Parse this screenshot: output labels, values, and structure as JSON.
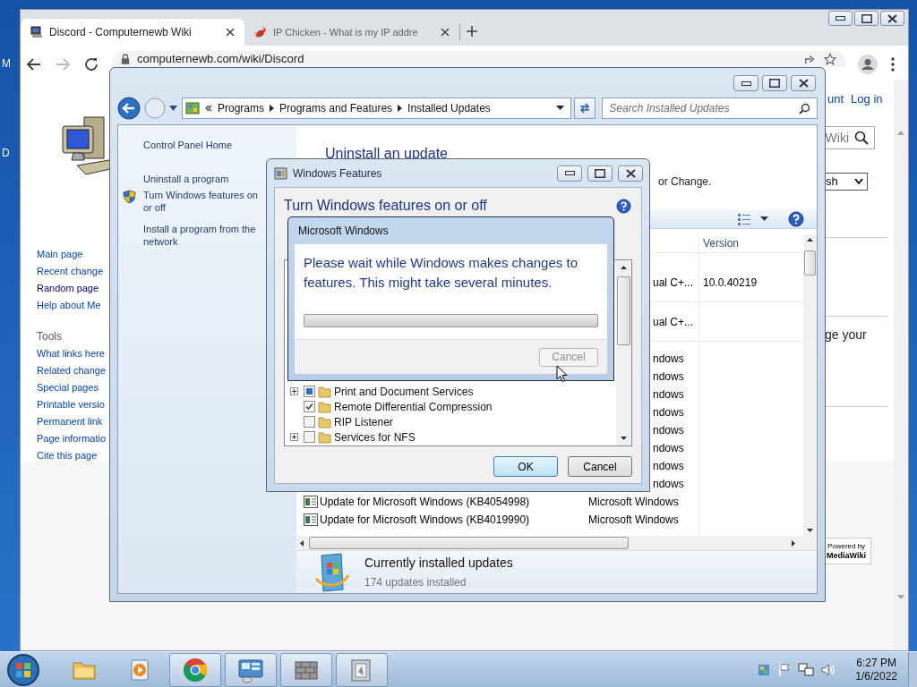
{
  "desktop": {
    "icon_labels": [
      "M",
      "D"
    ]
  },
  "browser": {
    "tabs": [
      {
        "title": "Discord - Computernewb Wiki",
        "selected": true
      },
      {
        "title": "IP Chicken - What is my IP addre",
        "selected": false
      }
    ],
    "address": "computernewb.com/wiki/Discord",
    "wiki": {
      "header_links": [
        "unt",
        "Log in"
      ],
      "search_placeholder": "Wiki",
      "language_select": "sh",
      "navigation": [
        {
          "label": "Main page",
          "visited": false
        },
        {
          "label": "Recent change",
          "visited": false
        },
        {
          "label": "Random page",
          "visited": true
        },
        {
          "label": "Help about Me",
          "visited": false
        }
      ],
      "tools_heading": "Tools",
      "tools": [
        "What links here",
        "Related change",
        "Special pages",
        "Printable versio",
        "Permanent link",
        "Page informatio",
        "Cite this page"
      ],
      "body_text": "ge your",
      "footer_badge": {
        "line_1": "Powered by",
        "line_2": "MediaWiki"
      }
    }
  },
  "control_panel": {
    "breadcrumb": [
      "Programs",
      "Programs and Features",
      "Installed Updates"
    ],
    "search_placeholder": "Search Installed Updates",
    "tasks": [
      {
        "label": "Control Panel Home",
        "kind": "link"
      },
      {
        "label": "Uninstall a program",
        "kind": "link"
      },
      {
        "label": "Turn Windows features on or off",
        "kind": "shield"
      },
      {
        "label": "Install a program from the network",
        "kind": "link"
      }
    ],
    "heading": "Uninstall an update",
    "subtitle": "or Change.",
    "columns": [
      "Version"
    ],
    "rows": [
      {
        "kind": "group",
        "program": "ual C+...",
        "version": "10.0.40219"
      },
      {
        "kind": "group",
        "program": "ual C+..."
      },
      {
        "kind": "partial",
        "program": "ndows"
      },
      {
        "kind": "partial",
        "program": "ndows"
      },
      {
        "kind": "partial",
        "program": "ndows"
      },
      {
        "kind": "partial",
        "program": "ndows"
      },
      {
        "kind": "partial",
        "program": "ndows"
      },
      {
        "kind": "partial",
        "program": "ndows"
      },
      {
        "kind": "partial",
        "program": "ndows"
      },
      {
        "kind": "partial",
        "program": "ndows"
      },
      {
        "kind": "full",
        "name": "Update for Microsoft Windows (KB4054998)",
        "program": "Microsoft Windows"
      },
      {
        "kind": "full",
        "name": "Update for Microsoft Windows (KB4019990)",
        "program": "Microsoft Windows"
      }
    ],
    "details": {
      "title": "Currently installed updates",
      "count": "174 updates installed"
    }
  },
  "features_dialog": {
    "title": "Windows Features",
    "heading": "Turn Windows features on or off",
    "features": [
      {
        "label": "Print and Document Services",
        "expandable": true,
        "checked": false,
        "partial": true
      },
      {
        "label": "Remote Differential Compression",
        "expandable": false,
        "checked": true,
        "partial": false
      },
      {
        "label": "RIP Listener",
        "expandable": false,
        "checked": false,
        "partial": false
      },
      {
        "label": "Services for NFS",
        "expandable": true,
        "checked": false,
        "partial": false
      }
    ],
    "buttons": [
      {
        "label": "OK",
        "default": true
      },
      {
        "label": "Cancel",
        "default": false
      }
    ]
  },
  "progress_dialog": {
    "title": "Microsoft Windows",
    "message": "Please wait while Windows makes changes to features. This might take several minutes.",
    "level": 0,
    "cancel": {
      "label": "Cancel",
      "disabled": true
    }
  },
  "taskbar": {
    "apps": [
      {
        "kind": "explorer",
        "running": false
      },
      {
        "kind": "media-player",
        "running": false
      },
      {
        "kind": "chrome",
        "running": true
      },
      {
        "kind": "control-panel",
        "running": true
      },
      {
        "kind": "firewall",
        "running": true
      },
      {
        "kind": "features",
        "running": true
      }
    ],
    "time": "6:27 PM",
    "date": "1/6/2022"
  }
}
